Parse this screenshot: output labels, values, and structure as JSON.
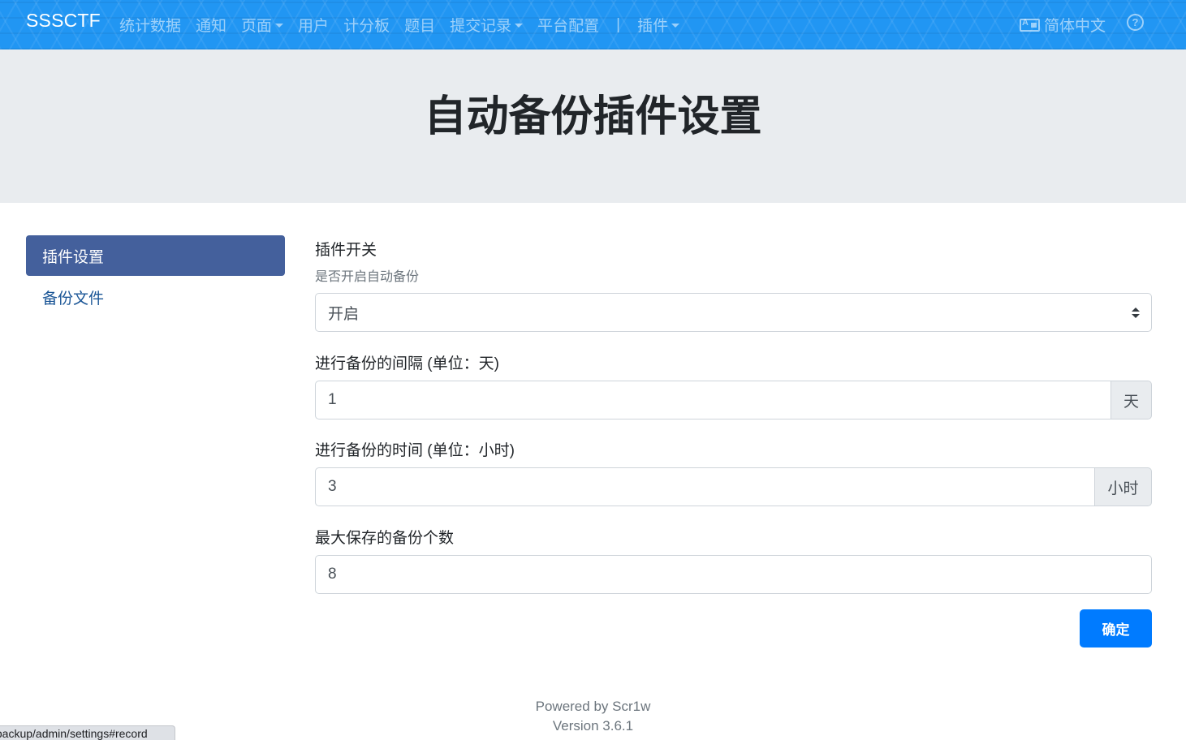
{
  "navbar": {
    "brand": "SSSCTF",
    "items": [
      {
        "label": "统计数据"
      },
      {
        "label": "通知"
      },
      {
        "label": "页面"
      },
      {
        "label": "用户"
      },
      {
        "label": "计分板"
      },
      {
        "label": "题目"
      },
      {
        "label": "提交记录"
      },
      {
        "label": "平台配置"
      },
      {
        "label": "插件"
      }
    ],
    "separator": "|",
    "language": "简体中文",
    "help_symbol": "?"
  },
  "page_title": "自动备份插件设置",
  "sidebar": {
    "items": [
      {
        "label": "插件设置",
        "active": true
      },
      {
        "label": "备份文件",
        "active": false
      }
    ]
  },
  "form": {
    "switch": {
      "label": "插件开关",
      "help": "是否开启自动备份",
      "value": "开启"
    },
    "interval": {
      "label": "进行备份的间隔 (单位：天)",
      "value": "1",
      "unit": "天"
    },
    "time": {
      "label": "进行备份的时间 (单位：小时)",
      "value": "3",
      "unit": "小时"
    },
    "max": {
      "label": "最大保存的备份个数",
      "value": "8"
    },
    "submit_label": "确定"
  },
  "footer": {
    "powered": "Powered by Scr1w",
    "version": "Version 3.6.1"
  },
  "status_url": "/backup/admin/settings#record",
  "colors": {
    "navbar": "#2196f3",
    "sidebar_active": "#44609c",
    "primary_button": "#007bff",
    "link": "#1a5596"
  }
}
